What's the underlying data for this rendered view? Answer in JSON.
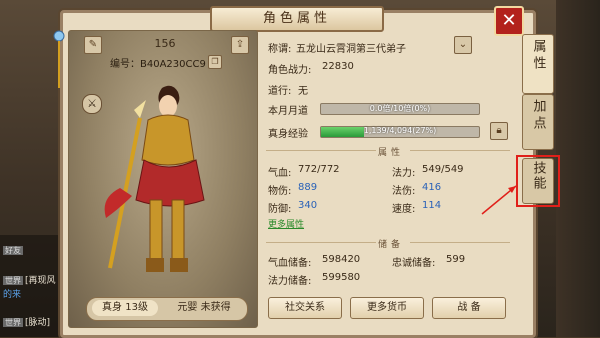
{
  "window": {
    "title": "角色属性",
    "close_label": "✕"
  },
  "character": {
    "power_number": "156",
    "code_label": "编号：",
    "code_value": "B40A230CC9",
    "realm_level": "真身 13级",
    "primordial": "元婴 未获得"
  },
  "info": {
    "title_label": "称谓:",
    "title_value": "五龙山云霄洞第三代弟子",
    "combat_label": "角色战力:",
    "combat_value": "22830",
    "dao_label": "道行:",
    "dao_value": "无",
    "monthly_label": "本月月道",
    "monthly_text": "0.0倍/10倍(0%)",
    "monthly_pct": 0,
    "exp_label": "真身经验",
    "exp_text": "1,139/4,094(27%)",
    "exp_pct": 27
  },
  "attributes": {
    "header": "属性",
    "hp_label": "气血:",
    "hp_value": "772/772",
    "mp_label": "法力:",
    "mp_value": "549/549",
    "phys_label": "物伤:",
    "phys_value": "889",
    "mag_label": "法伤:",
    "mag_value": "416",
    "def_label": "防御:",
    "def_value": "340",
    "speed_label": "速度:",
    "speed_value": "114",
    "more_label": "更多属性"
  },
  "reserve": {
    "header": "储备",
    "hp_res_label": "气血储备:",
    "hp_res_value": "598420",
    "loyal_label": "忠诚储备:",
    "loyal_value": "599",
    "mp_res_label": "法力储备:",
    "mp_res_value": "599580"
  },
  "buttons": {
    "social": "社交关系",
    "currency": "更多货币",
    "battle": "战 备"
  },
  "tabs": {
    "attr": "属性",
    "addpoint": "加点",
    "skill": "技能"
  },
  "chat": [
    {
      "tag": "好友",
      "text": ""
    },
    {
      "tag": "世界",
      "text": "[再现风"
    },
    {
      "tag": "",
      "text": "的来"
    },
    {
      "tag": "世界",
      "text": "[脉动]"
    }
  ],
  "colors": {
    "accent_blue": "#2a62b8",
    "exp_green": "#2a9a3a",
    "highlight_red": "#e0201a"
  }
}
